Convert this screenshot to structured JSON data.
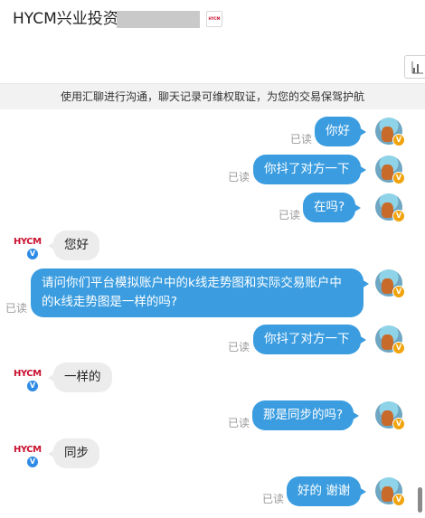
{
  "header": {
    "title": "HYCM兴业投资",
    "brand_badge": "HYCM"
  },
  "notice": "使用汇聊进行沟通，聊天记录可维权取证，为您的交易保驾护航",
  "read_label": "已读",
  "messages": [
    {
      "from": "me",
      "text": "你好"
    },
    {
      "from": "me",
      "text": "你抖了对方一下"
    },
    {
      "from": "me",
      "text": "在吗?"
    },
    {
      "from": "them",
      "text": "您好"
    },
    {
      "from": "me",
      "text": "请问你们平台模拟账户中的k线走势图和实际交易账户中的k线走势图是一样的吗?"
    },
    {
      "from": "me",
      "text": "你抖了对方一下"
    },
    {
      "from": "them",
      "text": "一样的"
    },
    {
      "from": "me",
      "text": "那是同步的吗?"
    },
    {
      "from": "them",
      "text": "同步"
    },
    {
      "from": "me",
      "text": "好的 谢谢"
    }
  ],
  "avatars": {
    "them_logo": "HYCM",
    "verified_mark": "V"
  }
}
